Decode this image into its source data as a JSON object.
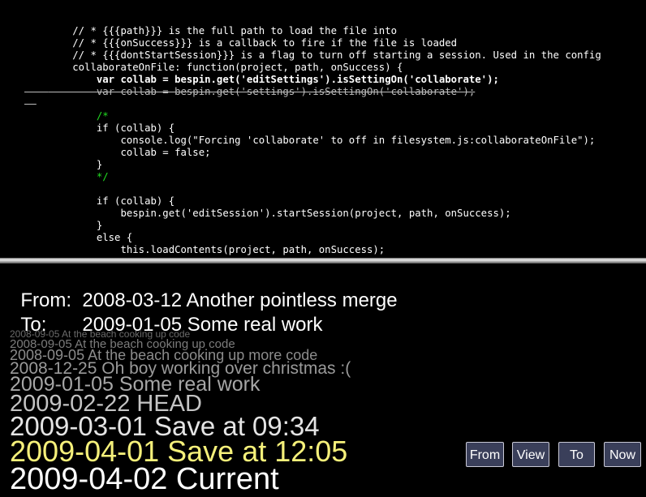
{
  "code": {
    "lines": [
      "    // * {{{path}}} is the full path to load the file into",
      "    // * {{{onSuccess}}} is a callback to fire if the file is loaded",
      "    // * {{{dontStartSession}}} is a flag to turn off starting a session. Used in the config",
      "    collaborateOnFile: function(project, path, onSuccess) {",
      "        var collab = bespin.get('editSettings').isSettingOn('collaborate');",
      "        var collab = bespin.get('settings').isSettingOn('collaborate');",
      "",
      "        /*",
      "        if (collab) {",
      "            console.log(\"Forcing 'collaborate' to off in filesystem.js:collaborateOnFile\");",
      "            collab = false;",
      "        }",
      "        */",
      "",
      "        if (collab) {",
      "            bespin.get('editSession').startSession(project, path, onSuccess);",
      "        }",
      "        else {",
      "            this.loadContents(project, path, onSuccess);"
    ]
  },
  "timeline": {
    "from_label": "From:",
    "from_value": "2008-03-12 Another pointless merge",
    "to_label": "To:",
    "to_value": "2009-01-05 Some real work"
  },
  "history": [
    "2008-09-05 At the beach cooking up code",
    "2008-09-05 At the beach cooking up code",
    "2008-09-05 At the beach cooking up more code",
    "2008-12-25 Oh boy working over christmas :(",
    "2009-01-05 Some real work",
    "2009-02-22 HEAD",
    "2009-03-01 Save at 09:34",
    "2009-04-01 Save at 12:05",
    "2009-04-02 Current"
  ],
  "buttons": {
    "from": "From",
    "view": "View",
    "to": "To",
    "now": "Now"
  },
  "colors": {
    "selected": "#f5f07a",
    "button_bg": "#3a3f5a"
  }
}
